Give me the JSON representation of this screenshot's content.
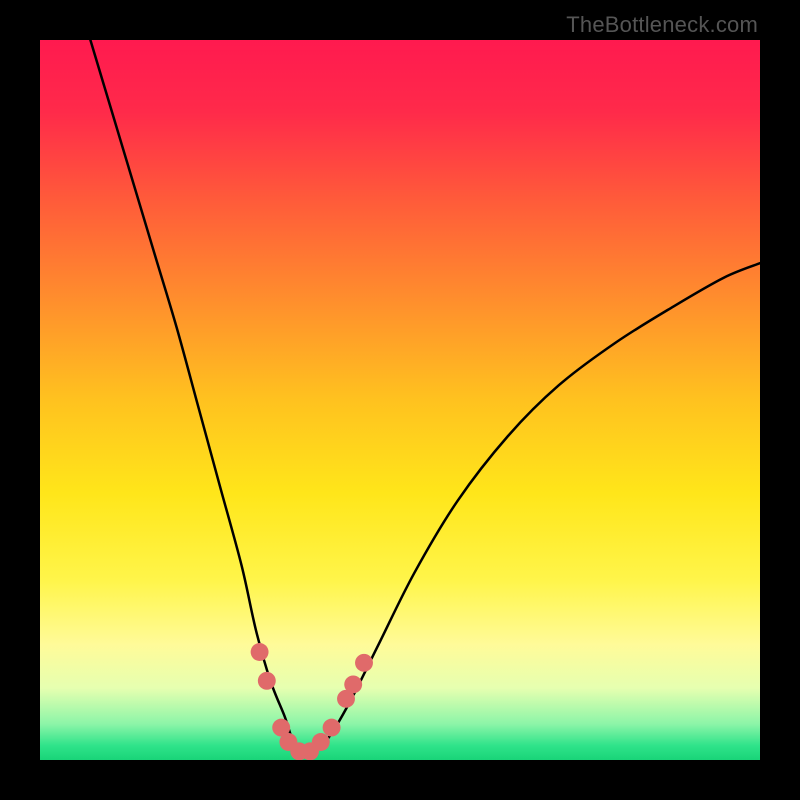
{
  "watermark": {
    "text": "TheBottleneck.com"
  },
  "gradient": {
    "stops": [
      {
        "offset": 0.0,
        "color": "#ff1a4f"
      },
      {
        "offset": 0.1,
        "color": "#ff2a4a"
      },
      {
        "offset": 0.22,
        "color": "#ff5a3a"
      },
      {
        "offset": 0.35,
        "color": "#ff8a2e"
      },
      {
        "offset": 0.5,
        "color": "#ffc21f"
      },
      {
        "offset": 0.63,
        "color": "#ffe61a"
      },
      {
        "offset": 0.75,
        "color": "#fff54a"
      },
      {
        "offset": 0.84,
        "color": "#fffb99"
      },
      {
        "offset": 0.9,
        "color": "#e6ffb0"
      },
      {
        "offset": 0.95,
        "color": "#8cf5a8"
      },
      {
        "offset": 0.98,
        "color": "#2fe38a"
      },
      {
        "offset": 1.0,
        "color": "#19d478"
      }
    ]
  },
  "chart_data": {
    "type": "line",
    "title": "",
    "xlabel": "",
    "ylabel": "",
    "xlim": [
      0,
      100
    ],
    "ylim": [
      0,
      100
    ],
    "grid": false,
    "legend": false,
    "series": [
      {
        "name": "bottleneck-curve",
        "x": [
          7,
          10,
          13,
          16,
          19,
          22,
          25,
          28,
          30,
          32,
          34,
          35,
          36,
          37,
          38,
          40,
          43,
          47,
          52,
          58,
          65,
          72,
          80,
          88,
          95,
          100
        ],
        "y": [
          100,
          90,
          80,
          70,
          60,
          49,
          38,
          27,
          18,
          11,
          6,
          3,
          1.5,
          1,
          1.5,
          3,
          8,
          16,
          26,
          36,
          45,
          52,
          58,
          63,
          67,
          69
        ]
      }
    ],
    "markers": {
      "name": "highlight-points",
      "color": "#e06a6a",
      "radius": 2.8,
      "points": [
        {
          "x": 30.5,
          "y": 15
        },
        {
          "x": 31.5,
          "y": 11
        },
        {
          "x": 33.5,
          "y": 4.5
        },
        {
          "x": 34.5,
          "y": 2.5
        },
        {
          "x": 36.0,
          "y": 1.2
        },
        {
          "x": 37.5,
          "y": 1.2
        },
        {
          "x": 39.0,
          "y": 2.5
        },
        {
          "x": 40.5,
          "y": 4.5
        },
        {
          "x": 42.5,
          "y": 8.5
        },
        {
          "x": 43.5,
          "y": 10.5
        },
        {
          "x": 45.0,
          "y": 13.5
        }
      ]
    }
  }
}
